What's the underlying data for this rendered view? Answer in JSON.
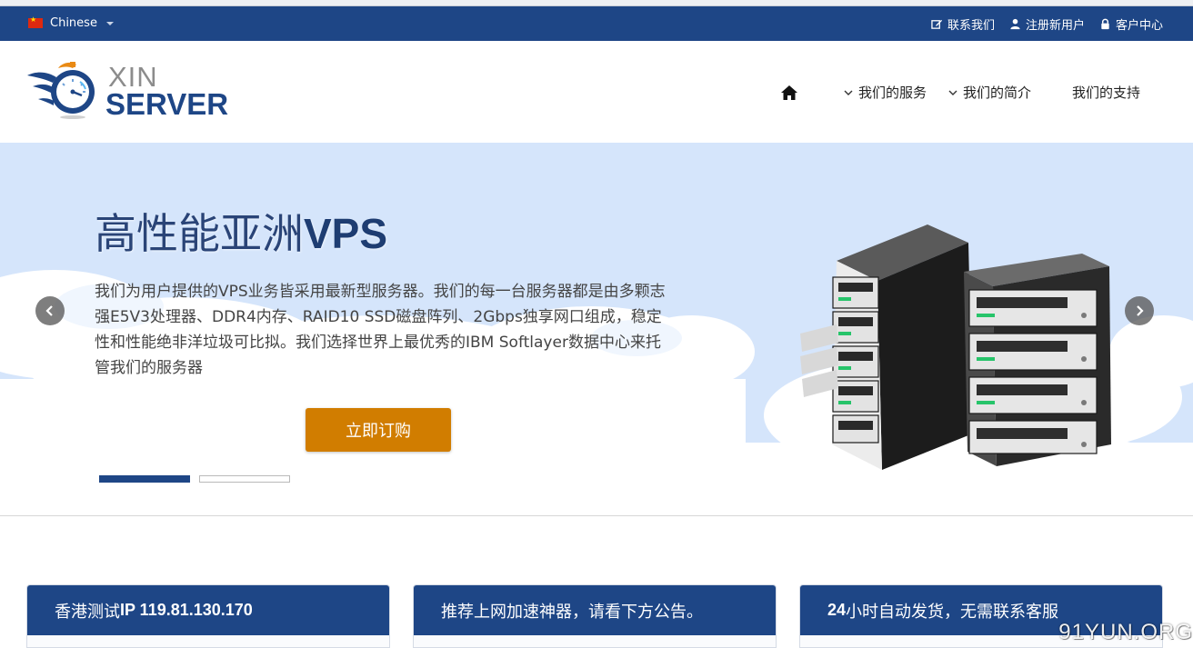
{
  "topbar": {
    "language": "Chinese",
    "links": [
      {
        "label": "联系我们",
        "icon": "edit-icon"
      },
      {
        "label": "注册新用户",
        "icon": "user-icon"
      },
      {
        "label": "客户中心",
        "icon": "lock-icon"
      }
    ]
  },
  "logo": {
    "line1": "XIN",
    "line2": "SERVER"
  },
  "nav": {
    "home_icon": "home-icon",
    "items": [
      {
        "label": "我们的服务",
        "dropdown": true
      },
      {
        "label": "我们的简介",
        "dropdown": true
      },
      {
        "label": "我们的支持",
        "dropdown": false
      }
    ]
  },
  "hero": {
    "title_cn": "高性能亚洲",
    "title_en": "VPS",
    "text": "我们为用户提供的VPS业务皆采用最新型服务器。我们的每一台服务器都是由多颗志强E5V3处理器、DDR4内存、RAID10 SSD磁盘阵列、2Gbps独享网口组成，稳定性和性能绝非洋垃圾可比拟。我们选择世界上最优秀的IBM Softlayer数据中心来托管我们的服务器",
    "cta": "立即订购",
    "slides_total": 2,
    "slide_active": 1
  },
  "cards": [
    {
      "title_prefix": "香港测试",
      "title_bold": "IP 119.81.130.170",
      "title_suffix": ""
    },
    {
      "title_prefix": "推荐上网加速神器，请看下方公告。",
      "title_bold": "",
      "title_suffix": ""
    },
    {
      "title_prefix": "",
      "title_bold": "24",
      "title_suffix": "小时自动发货，无需联系客服"
    }
  ],
  "watermark": "91YUN.ORG",
  "colors": {
    "brand_blue": "#1e4686",
    "cta_orange": "#d17d00",
    "hero_bg": "#d5e5fb"
  }
}
